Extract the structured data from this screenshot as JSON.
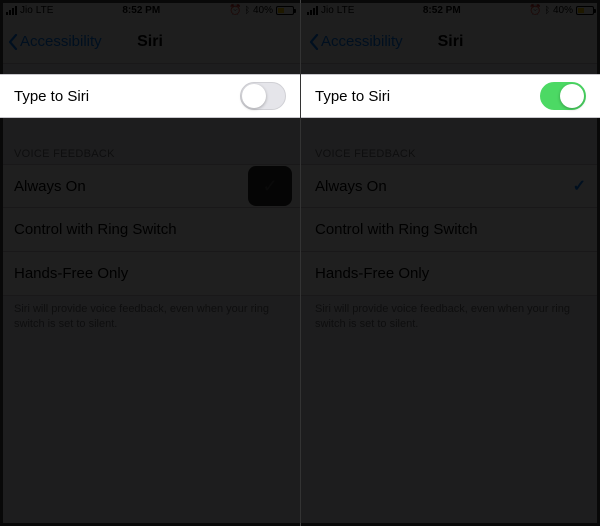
{
  "status": {
    "carrier": "Jio",
    "network": "LTE",
    "time": "8:52 PM",
    "alarm_icon": "alarm",
    "bluetooth_icon": "bluetooth",
    "battery_pct": "40%"
  },
  "nav": {
    "back_label": "Accessibility",
    "title": "Siri"
  },
  "left": {
    "type_to_siri": {
      "label": "Type to Siri",
      "on": false
    }
  },
  "right": {
    "type_to_siri": {
      "label": "Type to Siri",
      "on": true
    }
  },
  "voice_feedback": {
    "header": "VOICE FEEDBACK",
    "options": [
      {
        "label": "Always On",
        "selected": true
      },
      {
        "label": "Control with Ring Switch",
        "selected": false
      },
      {
        "label": "Hands-Free Only",
        "selected": false
      }
    ],
    "footer": "Siri will provide voice feedback, even when your ring switch is set to silent."
  },
  "colors": {
    "ios_blue": "#007aff",
    "ios_green": "#4cd964"
  }
}
